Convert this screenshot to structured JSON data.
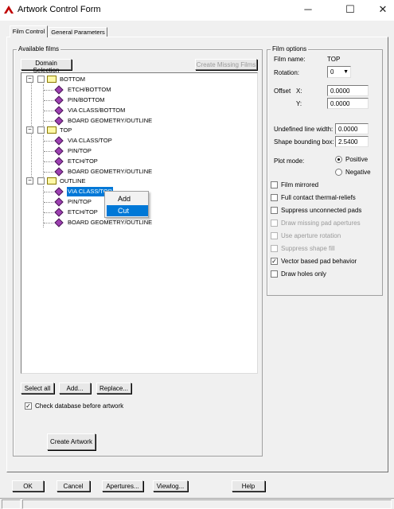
{
  "window": {
    "title": "Artwork Control Form",
    "controls": {
      "minimize": "─",
      "maximize": "☐",
      "close": "✕"
    }
  },
  "tabs": [
    {
      "label": "Film Control",
      "active": true
    },
    {
      "label": "General Parameters",
      "active": false
    }
  ],
  "available_films": {
    "group_label": "Available films",
    "domain_selection": "Domain Selection",
    "create_missing": "Create Missing Films",
    "tree": [
      {
        "name": "BOTTOM",
        "children": [
          "ETCH/BOTTOM",
          "PIN/BOTTOM",
          "VIA CLASS/BOTTOM",
          "BOARD GEOMETRY/OUTLINE"
        ]
      },
      {
        "name": "TOP",
        "children": [
          "VIA CLASS/TOP",
          "PIN/TOP",
          "ETCH/TOP",
          "BOARD GEOMETRY/OUTLINE"
        ]
      },
      {
        "name": "OUTLINE",
        "children": [
          "VIA CLASS/TOP",
          "PIN/TOP",
          "ETCH/TOP",
          "BOARD GEOMETRY/OUTLINE"
        ]
      }
    ],
    "selected_item": "VIA CLASS/TOP",
    "buttons": {
      "select_all": "Select all",
      "add": "Add...",
      "replace": "Replace..."
    },
    "check_db": {
      "label": "Check database before artwork",
      "checked": true
    },
    "create_artwork": "Create Artwork"
  },
  "context_menu": {
    "items": [
      "Add",
      "Cut"
    ],
    "highlighted": "Cut"
  },
  "film_options": {
    "group_label": "Film options",
    "film_name_label": "Film name:",
    "film_name_value": "TOP",
    "rotation_label": "Rotation:",
    "rotation_value": "0",
    "offset_label": "Offset",
    "x_label": "X:",
    "x_value": "0.0000",
    "y_label": "Y:",
    "y_value": "0.0000",
    "undefined_line_width_label": "Undefined line width:",
    "undefined_line_width_value": "0.0000",
    "shape_bounding_box_label": "Shape bounding box:",
    "shape_bounding_box_value": "2.5400",
    "plot_mode_label": "Plot mode:",
    "plot_positive": "Positive",
    "plot_negative": "Negative",
    "checkboxes": [
      {
        "label": "Film mirrored",
        "checked": false,
        "enabled": true
      },
      {
        "label": "Full contact thermal-reliefs",
        "checked": false,
        "enabled": true
      },
      {
        "label": "Suppress unconnected pads",
        "checked": false,
        "enabled": true
      },
      {
        "label": "Draw missing pad apertures",
        "checked": false,
        "enabled": false
      },
      {
        "label": "Use aperture rotation",
        "checked": false,
        "enabled": false
      },
      {
        "label": "Suppress shape fill",
        "checked": false,
        "enabled": false
      },
      {
        "label": "Vector based pad behavior",
        "checked": true,
        "enabled": true
      },
      {
        "label": "Draw holes only",
        "checked": false,
        "enabled": true
      }
    ]
  },
  "bottom_buttons": {
    "ok": "OK",
    "cancel": "Cancel",
    "apertures": "Apertures...",
    "viewlog": "Viewlog...",
    "help": "Help"
  }
}
